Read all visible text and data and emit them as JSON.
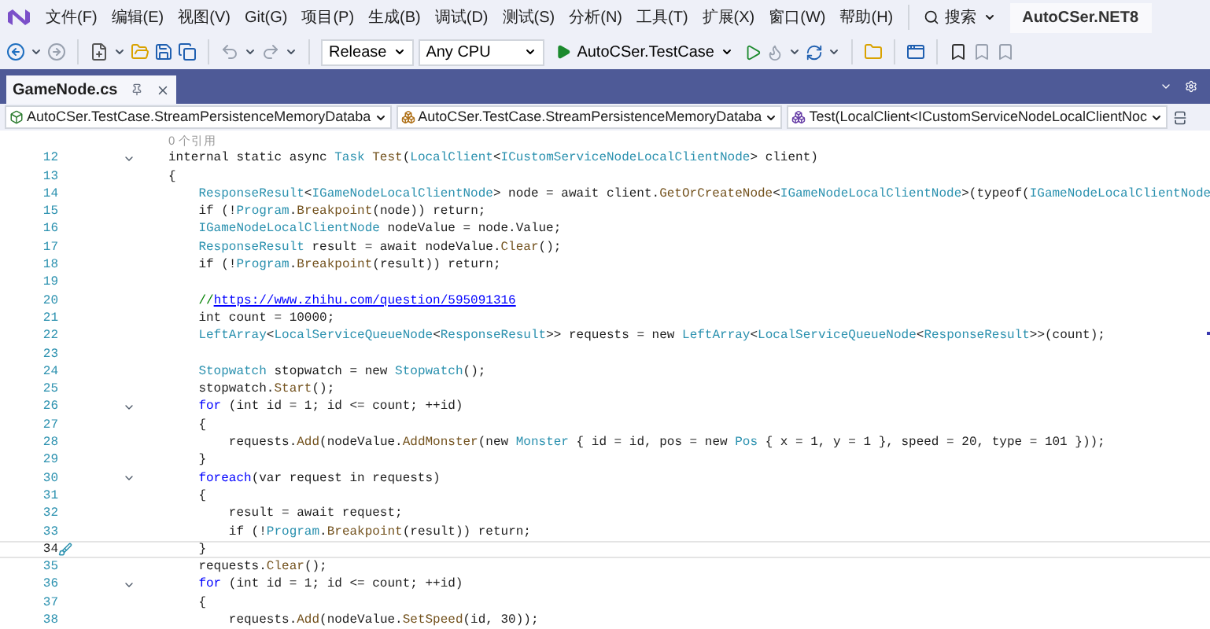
{
  "menu": {
    "items": [
      "文件(F)",
      "编辑(E)",
      "视图(V)",
      "Git(G)",
      "项目(P)",
      "生成(B)",
      "调试(D)",
      "测试(S)",
      "分析(N)",
      "工具(T)",
      "扩展(X)",
      "窗口(W)",
      "帮助(H)"
    ]
  },
  "search": {
    "label": "搜索"
  },
  "solution": "AutoCSer.NET8",
  "toolbar": {
    "configuration": "Release",
    "platform": "Any CPU",
    "startup": "AutoCSer.TestCase"
  },
  "tabs": [
    {
      "label": "GameNode.cs",
      "selected": true
    }
  ],
  "nav": [
    {
      "kind": "project",
      "label": "AutoCSer.TestCase.StreamPersistenceMemoryDataba"
    },
    {
      "kind": "class",
      "label": "AutoCSer.TestCase.StreamPersistenceMemoryDataba"
    },
    {
      "kind": "method",
      "label": "Test(LocalClient<ICustomServiceNodeLocalClientNoc"
    }
  ],
  "codelens": "0 个引用",
  "lines": [
    {
      "number": "12",
      "foldable": true,
      "current": false,
      "tokens": [
        {
          "kind": "plain",
          "text": "internal static async "
        },
        {
          "kind": "type",
          "text": "Task"
        },
        {
          "kind": "method",
          "text": " Test"
        },
        {
          "kind": "plain",
          "text": "("
        },
        {
          "kind": "type",
          "text": "LocalClient"
        },
        {
          "kind": "plain",
          "text": "<"
        },
        {
          "kind": "type",
          "text": "ICustomServiceNodeLocalClientNode"
        },
        {
          "kind": "plain",
          "text": "> client)"
        }
      ]
    },
    {
      "number": "13",
      "foldable": false,
      "current": false,
      "tokens": [
        {
          "kind": "plain",
          "text": "{"
        }
      ]
    },
    {
      "number": "14",
      "foldable": false,
      "current": false,
      "tokens": [
        {
          "kind": "type",
          "text": "    ResponseResult"
        },
        {
          "kind": "plain",
          "text": "<"
        },
        {
          "kind": "type",
          "text": "IGameNodeLocalClientNode"
        },
        {
          "kind": "plain",
          "text": "> node = await client."
        },
        {
          "kind": "method",
          "text": "GetOrCreateNode"
        },
        {
          "kind": "plain",
          "text": "<"
        },
        {
          "kind": "type",
          "text": "IGameNodeLocalClientNode"
        },
        {
          "kind": "plain",
          "text": ">(typeof("
        },
        {
          "kind": "type",
          "text": "IGameNodeLocalClientNode"
        }
      ]
    },
    {
      "number": "15",
      "foldable": false,
      "current": false,
      "tokens": [
        {
          "kind": "plain",
          "text": "    if (!"
        },
        {
          "kind": "type",
          "text": "Program"
        },
        {
          "kind": "plain",
          "text": "."
        },
        {
          "kind": "method",
          "text": "Breakpoint"
        },
        {
          "kind": "plain",
          "text": "(node)) return;"
        }
      ]
    },
    {
      "number": "16",
      "foldable": false,
      "current": false,
      "tokens": [
        {
          "kind": "type",
          "text": "    IGameNodeLocalClientNode"
        },
        {
          "kind": "plain",
          "text": " nodeValue = node.Value;"
        }
      ]
    },
    {
      "number": "17",
      "foldable": false,
      "current": false,
      "tokens": [
        {
          "kind": "type",
          "text": "    ResponseResult"
        },
        {
          "kind": "plain",
          "text": " result = await nodeValue."
        },
        {
          "kind": "method",
          "text": "Clear"
        },
        {
          "kind": "plain",
          "text": "();"
        }
      ]
    },
    {
      "number": "18",
      "foldable": false,
      "current": false,
      "tokens": [
        {
          "kind": "plain",
          "text": "    if (!"
        },
        {
          "kind": "type",
          "text": "Program"
        },
        {
          "kind": "plain",
          "text": "."
        },
        {
          "kind": "method",
          "text": "Breakpoint"
        },
        {
          "kind": "plain",
          "text": "(result)) return;"
        }
      ]
    },
    {
      "number": "19",
      "foldable": false,
      "current": false
    },
    {
      "number": "20",
      "foldable": false,
      "current": false,
      "tokens": [
        {
          "kind": "comment",
          "text": "    //"
        },
        {
          "kind": "link",
          "text": "https://www.zhihu.com/question/595091316"
        }
      ]
    },
    {
      "number": "21",
      "foldable": false,
      "current": false,
      "tokens": [
        {
          "kind": "plain",
          "text": "    int count = 10000;"
        }
      ]
    },
    {
      "number": "22",
      "foldable": false,
      "current": false,
      "tokens": [
        {
          "kind": "type",
          "text": "    LeftArray"
        },
        {
          "kind": "plain",
          "text": "<"
        },
        {
          "kind": "type",
          "text": "LocalServiceQueueNode"
        },
        {
          "kind": "plain",
          "text": "<"
        },
        {
          "kind": "type",
          "text": "ResponseResult"
        },
        {
          "kind": "plain",
          "text": ">> requests = new "
        },
        {
          "kind": "type",
          "text": "LeftArray"
        },
        {
          "kind": "plain",
          "text": "<"
        },
        {
          "kind": "type",
          "text": "LocalServiceQueueNode"
        },
        {
          "kind": "plain",
          "text": "<"
        },
        {
          "kind": "type",
          "text": "ResponseResult"
        },
        {
          "kind": "plain",
          "text": ">>(count);"
        }
      ]
    },
    {
      "number": "23",
      "foldable": false,
      "current": false
    },
    {
      "number": "24",
      "foldable": false,
      "current": false,
      "tokens": [
        {
          "kind": "type",
          "text": "    Stopwatch"
        },
        {
          "kind": "plain",
          "text": " stopwatch = new "
        },
        {
          "kind": "type",
          "text": "Stopwatch"
        },
        {
          "kind": "plain",
          "text": "();"
        }
      ]
    },
    {
      "number": "25",
      "foldable": false,
      "current": false,
      "tokens": [
        {
          "kind": "plain",
          "text": "    stopwatch."
        },
        {
          "kind": "method",
          "text": "Start"
        },
        {
          "kind": "plain",
          "text": "();"
        }
      ]
    },
    {
      "number": "26",
      "foldable": true,
      "current": false,
      "tokens": [
        {
          "kind": "keyword",
          "text": "    for"
        },
        {
          "kind": "plain",
          "text": " (int id = 1; id <= count; ++id)"
        }
      ]
    },
    {
      "number": "27",
      "foldable": false,
      "current": false,
      "tokens": [
        {
          "kind": "plain",
          "text": "    {"
        }
      ]
    },
    {
      "number": "28",
      "foldable": false,
      "current": false,
      "tokens": [
        {
          "kind": "plain",
          "text": "        requests."
        },
        {
          "kind": "method",
          "text": "Add"
        },
        {
          "kind": "plain",
          "text": "(nodeValue."
        },
        {
          "kind": "method",
          "text": "AddMonster"
        },
        {
          "kind": "plain",
          "text": "(new "
        },
        {
          "kind": "type",
          "text": "Monster"
        },
        {
          "kind": "plain",
          "text": " { id = id, pos = new "
        },
        {
          "kind": "type",
          "text": "Pos"
        },
        {
          "kind": "plain",
          "text": " { x = 1, y = 1 }, speed = 20, type = 101 }));"
        }
      ]
    },
    {
      "number": "29",
      "foldable": false,
      "current": false,
      "tokens": [
        {
          "kind": "plain",
          "text": "    }"
        }
      ]
    },
    {
      "number": "30",
      "foldable": true,
      "current": false,
      "tokens": [
        {
          "kind": "keyword",
          "text": "    foreach"
        },
        {
          "kind": "plain",
          "text": "(var request in requests)"
        }
      ]
    },
    {
      "number": "31",
      "foldable": false,
      "current": false,
      "tokens": [
        {
          "kind": "plain",
          "text": "    {"
        }
      ]
    },
    {
      "number": "32",
      "foldable": false,
      "current": false,
      "tokens": [
        {
          "kind": "plain",
          "text": "        result = await request;"
        }
      ]
    },
    {
      "number": "33",
      "foldable": false,
      "current": false,
      "tokens": [
        {
          "kind": "plain",
          "text": "        if (!"
        },
        {
          "kind": "type",
          "text": "Program"
        },
        {
          "kind": "plain",
          "text": "."
        },
        {
          "kind": "method",
          "text": "Breakpoint"
        },
        {
          "kind": "plain",
          "text": "(result)) return;"
        }
      ]
    },
    {
      "number": "34",
      "foldable": false,
      "current": true,
      "tokens": [
        {
          "kind": "plain",
          "text": "    }"
        }
      ]
    },
    {
      "number": "35",
      "foldable": false,
      "current": false,
      "tokens": [
        {
          "kind": "plain",
          "text": "    requests."
        },
        {
          "kind": "method",
          "text": "Clear"
        },
        {
          "kind": "plain",
          "text": "();"
        }
      ]
    },
    {
      "number": "36",
      "foldable": true,
      "current": false,
      "tokens": [
        {
          "kind": "keyword",
          "text": "    for"
        },
        {
          "kind": "plain",
          "text": " (int id = 1; id <= count; ++id)"
        }
      ]
    },
    {
      "number": "37",
      "foldable": false,
      "current": false,
      "tokens": [
        {
          "kind": "plain",
          "text": "    {"
        }
      ]
    },
    {
      "number": "38",
      "foldable": false,
      "current": false,
      "tokens": [
        {
          "kind": "plain",
          "text": "        requests."
        },
        {
          "kind": "method",
          "text": "Add"
        },
        {
          "kind": "plain",
          "text": "(nodeValue."
        },
        {
          "kind": "method",
          "text": "SetSpeed"
        },
        {
          "kind": "plain",
          "text": "(id, 30));"
        }
      ]
    }
  ]
}
